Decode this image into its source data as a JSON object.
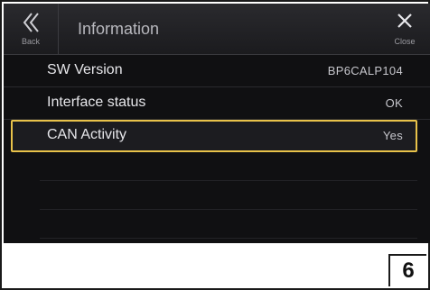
{
  "header": {
    "title": "Information",
    "back_label": "Back",
    "close_label": "Close"
  },
  "rows": [
    {
      "label": "SW Version",
      "value": "BP6CALP104"
    },
    {
      "label": "Interface status",
      "value": "OK"
    },
    {
      "label": "CAN Activity",
      "value": "Yes",
      "selected": true
    }
  ],
  "figure": {
    "number": "6"
  },
  "colors": {
    "screen_bg": "#101012",
    "highlight": "#e8c24a",
    "text": "#e6e6ea"
  },
  "icons": [
    "back-chevrons-icon",
    "close-icon"
  ]
}
